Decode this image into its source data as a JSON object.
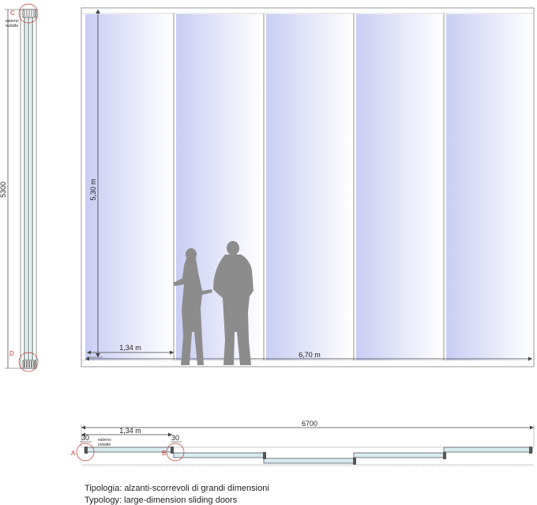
{
  "side_view": {
    "height_label": "5300",
    "marker_top": "C",
    "marker_bottom": "D",
    "outside_it": "esterno",
    "outside_en": "outside"
  },
  "elevation": {
    "height_dim": "5,30 m",
    "panel_width_dim": "1,34 m",
    "total_width_dim": "6,70 m",
    "panel_count": 5
  },
  "plan": {
    "total_width": "6700",
    "panel_width": "1,34 m",
    "frame_a": "30",
    "frame_b": "30",
    "marker_a": "A",
    "marker_b": "B",
    "outside_it": "esterno",
    "outside_en": "outside"
  },
  "captions": {
    "typology_it": "Tipologia: alzanti-scorrevoli di grandi dimensioni",
    "typology_en": "Typology: large-dimension sliding doors"
  },
  "colors": {
    "glass": "#c9cdf3",
    "frame": "#9a9a9a",
    "silhouette": "#8c8c8c",
    "marker": "#c0392b"
  }
}
